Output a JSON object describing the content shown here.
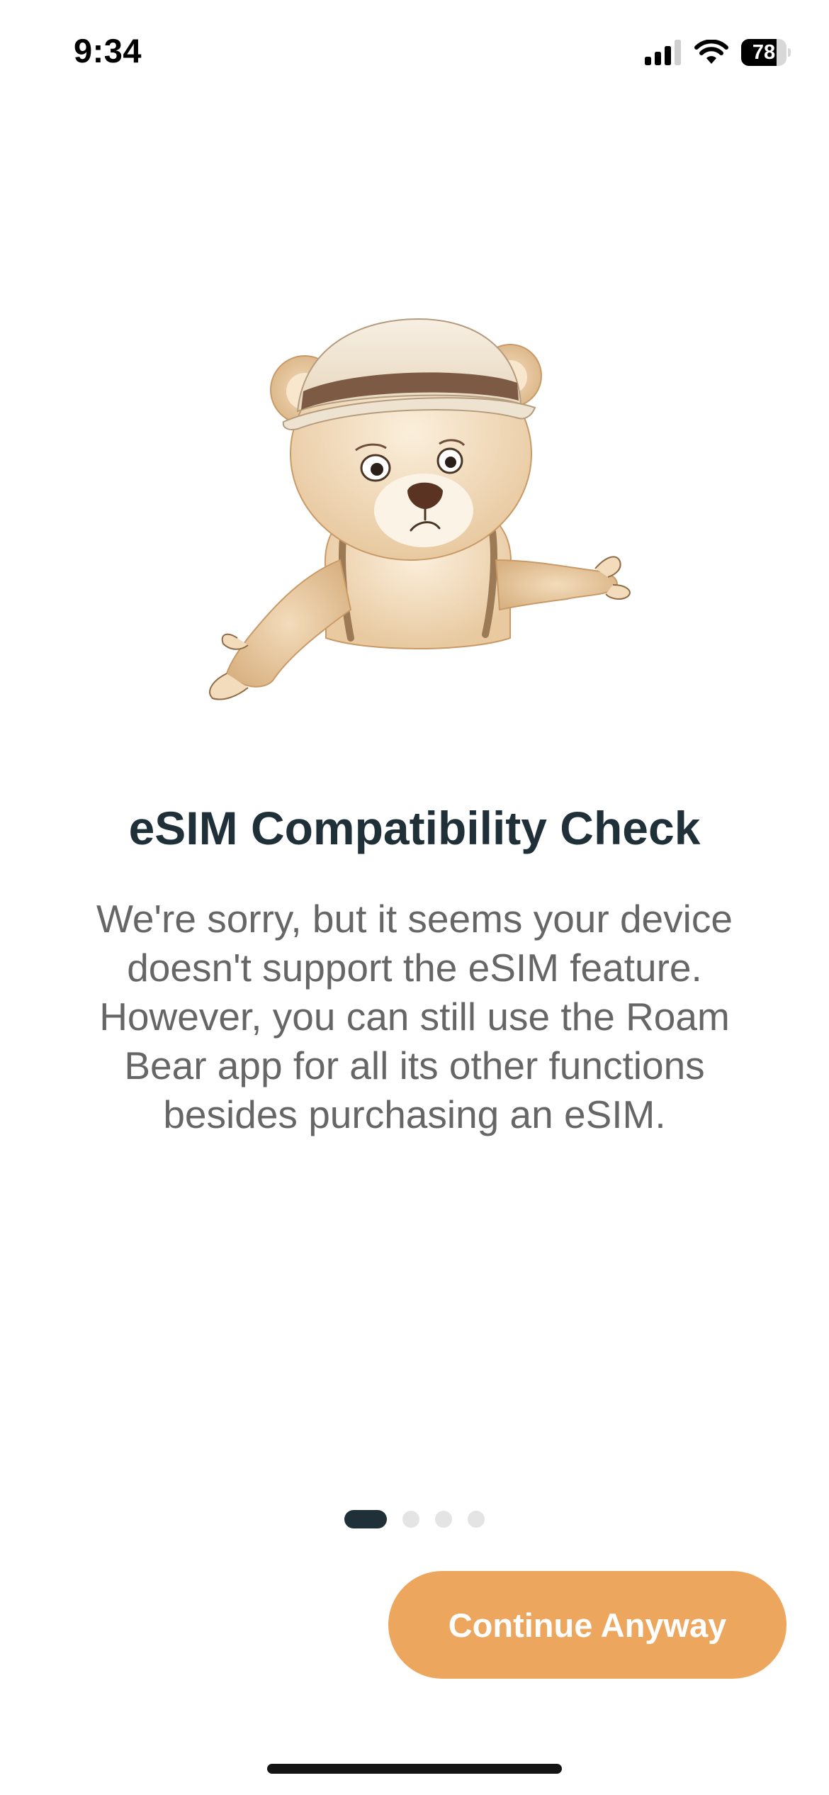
{
  "status_bar": {
    "time": "9:34",
    "battery_level": "78",
    "battery_fraction": 0.78,
    "icons": [
      "signal-icon",
      "wifi-icon",
      "battery-icon"
    ]
  },
  "illustration": {
    "name": "sad-bear-illustration"
  },
  "screen": {
    "title": "eSIM Compatibility Check",
    "message": "We're sorry, but it seems your device doesn't support the eSIM feature. However, you can still use the Roam Bear app for all its other functions besides purchasing an eSIM."
  },
  "pagination": {
    "total": 4,
    "active_index": 0
  },
  "actions": {
    "continue_label": "Continue Anyway"
  },
  "colors": {
    "title": "#1f3039",
    "body_text": "#666666",
    "accent_button": "#eda65e",
    "active_dot": "#1f3039",
    "inactive_dot": "#e4e4e4"
  }
}
